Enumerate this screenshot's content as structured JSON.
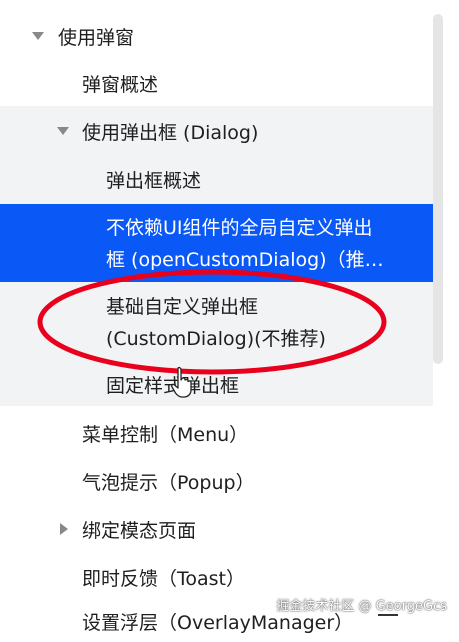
{
  "tree": {
    "use_popup": "使用弹窗",
    "popup_overview": "弹窗概述",
    "use_dialog": "使用弹出框 (Dialog)",
    "dialog_overview": "弹出框概述",
    "global_dialog_line1": "不依赖UI组件的全局自定义弹出",
    "global_dialog_line2": "框 (openCustomDialog)（推…",
    "custom_dialog_line1": "基础自定义弹出框",
    "custom_dialog_line2": "(CustomDialog)(不推荐)",
    "fixed_style_dialog": "固定样式弹出框",
    "menu": "菜单控制（Menu）",
    "popup": "气泡提示（Popup）",
    "bind_modal": "绑定模态页面",
    "toast": "即时反馈（Toast）",
    "overlay": "设置浮层（OverlayManager）"
  },
  "watermark": "掘金技术社区 @ GeorgeGcs",
  "colors": {
    "active_bg": "#0a59f7",
    "hover_bg": "#f1f3f5",
    "annotation": "#e8001c"
  }
}
